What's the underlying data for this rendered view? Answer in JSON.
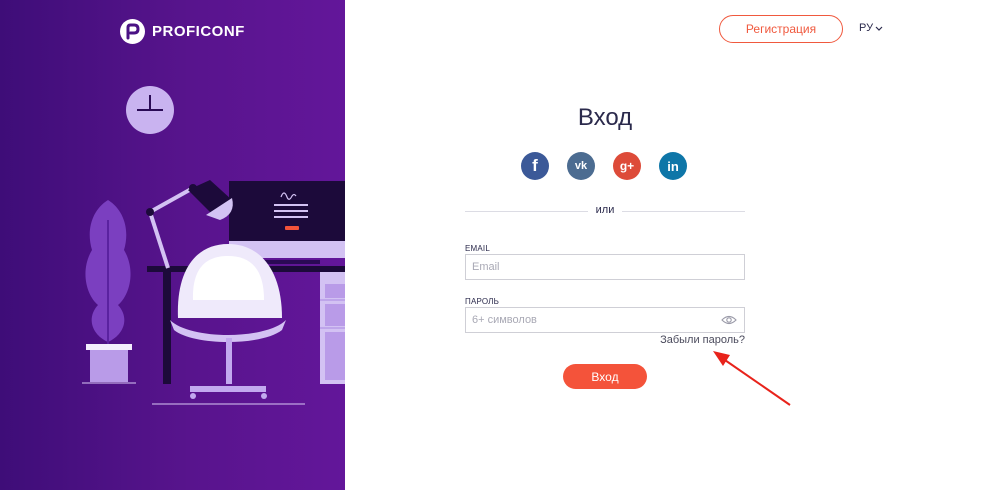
{
  "brand": {
    "name": "PROFICONF"
  },
  "header": {
    "register_label": "Регистрация",
    "language": "РУ"
  },
  "login": {
    "title": "Вход",
    "social": [
      "facebook-icon",
      "vk-icon",
      "google-plus-icon",
      "linkedin-icon"
    ],
    "social_glyphs": {
      "facebook": "f",
      "vk": "vk",
      "google": "g+",
      "linkedin": "in"
    },
    "divider_text": "или",
    "email_label": "EMAIL",
    "email_placeholder": "Email",
    "password_label": "ПАРОЛЬ",
    "password_placeholder": "6+ символов",
    "forgot_label": "Забыли пароль?",
    "submit_label": "Вход"
  },
  "colors": {
    "accent": "#f4533a",
    "panel_start": "#3e0d78",
    "panel_end": "#63169a",
    "facebook": "#3b5998",
    "vk": "#4c6c91",
    "google": "#dd4b39",
    "linkedin": "#0e76a8",
    "annotation_arrow": "#e8231b"
  }
}
